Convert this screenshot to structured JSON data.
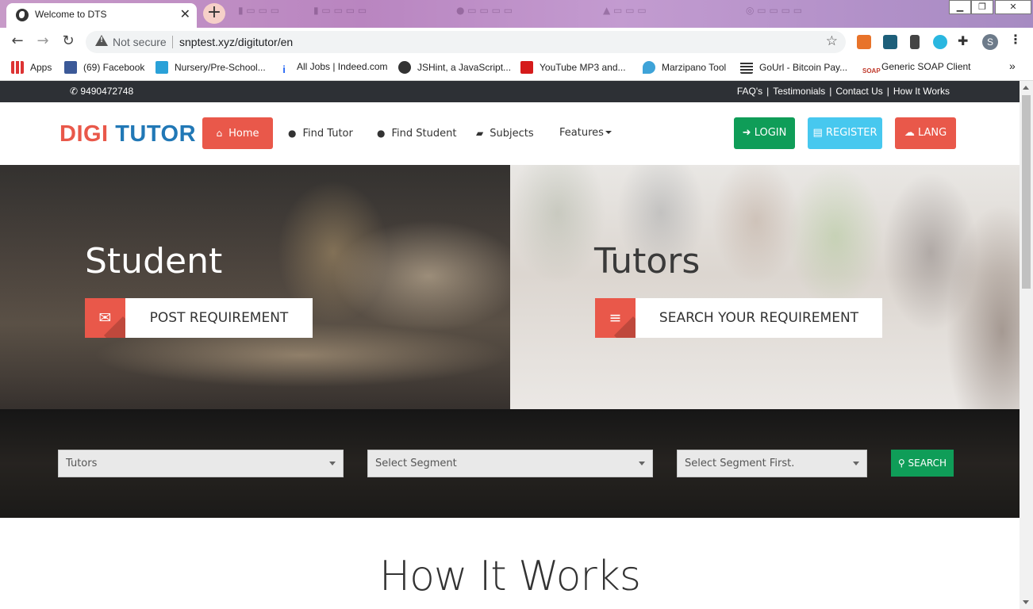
{
  "browser": {
    "active_tab_title": "Welcome to DTS",
    "security_label": "Not secure",
    "url": "snptest.xyz/digitutor/en",
    "bookmarks": [
      {
        "label": "Apps"
      },
      {
        "label": "(69) Facebook"
      },
      {
        "label": "Nursery/Pre-School..."
      },
      {
        "label": "All Jobs | Indeed.com"
      },
      {
        "label": "JSHint, a JavaScript..."
      },
      {
        "label": "YouTube MP3 and..."
      },
      {
        "label": "Marzipano Tool"
      },
      {
        "label": "GoUrl - Bitcoin Pay..."
      },
      {
        "label": "Generic SOAP Client"
      }
    ],
    "bookmark_overflow": "»",
    "profile_initial": "S"
  },
  "topbar": {
    "phone": "9490472748",
    "links": [
      "FAQ's",
      "Testimonials",
      "Contact Us",
      "How It Works"
    ]
  },
  "logo": {
    "part1": "DIGI",
    "part2": "TUTOR"
  },
  "nav": {
    "items": [
      {
        "label": "Home",
        "icon": "home-icon"
      },
      {
        "label": "Find Tutor",
        "icon": "user-icon"
      },
      {
        "label": "Find Student",
        "icon": "user-icon"
      },
      {
        "label": "Subjects",
        "icon": "book-icon"
      },
      {
        "label": "Features",
        "icon": "caret-down-icon"
      }
    ],
    "login": "LOGIN",
    "register": "REGISTER",
    "lang": "LANG"
  },
  "hero": {
    "left_title": "Student",
    "left_cta": "POST REQUIREMENT",
    "right_title": "Tutors",
    "right_cta": "SEARCH YOUR REQUIREMENT"
  },
  "search": {
    "select1": "Tutors",
    "select2": "Select Segment",
    "select3": "Select Segment First.",
    "button": "SEARCH"
  },
  "how_it_works": {
    "title": "How It Works"
  },
  "colors": {
    "accent_red": "#e9584a",
    "logo_blue": "#2178b6",
    "green": "#0f9d58",
    "cyan": "#47c8ef",
    "topbar_dark": "#2d3035"
  }
}
